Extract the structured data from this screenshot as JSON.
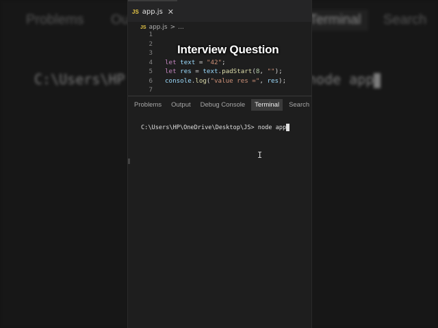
{
  "background": {
    "tabs": [
      "Problems",
      "Output",
      "Terminal",
      "Search"
    ],
    "terminal_left": "C:\\Users\\HP",
    "terminal_right": "node app"
  },
  "editor": {
    "tab": {
      "badge": "JS",
      "filename": "app.js",
      "close": "✕"
    },
    "breadcrumb": {
      "badge": "JS",
      "file": "app.js",
      "separator": ">",
      "ellipsis": "..."
    },
    "lines": [
      {
        "num": "1",
        "text": ""
      },
      {
        "num": "2",
        "text": ""
      },
      {
        "num": "3",
        "text": ""
      },
      {
        "num": "4",
        "text": "let text = \"42\";"
      },
      {
        "num": "5",
        "text": "let res = text.padStart(8, \"\");"
      },
      {
        "num": "6",
        "text": "console.log(\"value res =\", res);"
      },
      {
        "num": "7",
        "text": ""
      }
    ]
  },
  "overlay": {
    "title": "Interview Question"
  },
  "panel": {
    "tabs": [
      {
        "label": "Problems",
        "active": false
      },
      {
        "label": "Output",
        "active": false
      },
      {
        "label": "Debug Console",
        "active": false
      },
      {
        "label": "Terminal",
        "active": true
      },
      {
        "label": "Search",
        "active": false
      }
    ]
  },
  "terminal": {
    "prompt": "C:\\Users\\HP\\OneDrive\\Desktop\\JS>",
    "command": "node app",
    "mouse_cursor": "I"
  },
  "colors": {
    "editor_bg": "#1e1e1e",
    "js_badge": "#e8c846",
    "keyword": "#c586c0",
    "string": "#ce9178",
    "function": "#dcdcaa"
  }
}
